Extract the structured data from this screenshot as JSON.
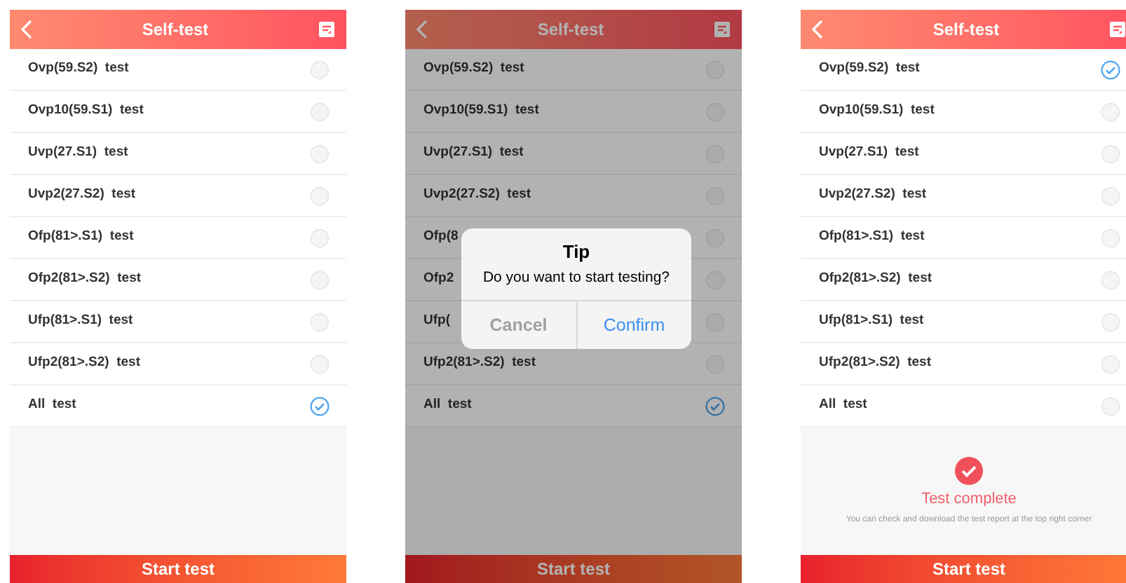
{
  "screens": [
    {
      "title": "Self-test",
      "dimmed": false,
      "tests": [
        {
          "label": "Ovp(59.S2)  test",
          "checked": false
        },
        {
          "label": "Ovp10(59.S1)  test",
          "checked": false
        },
        {
          "label": "Uvp(27.S1)  test",
          "checked": false
        },
        {
          "label": "Uvp2(27.S2)  test",
          "checked": false
        },
        {
          "label": "Ofp(81>.S1)  test",
          "checked": false
        },
        {
          "label": "Ofp2(81>.S2)  test",
          "checked": false
        },
        {
          "label": "Ufp(81>.S1)  test",
          "checked": false
        },
        {
          "label": "Ufp2(81>.S2)  test",
          "checked": false
        },
        {
          "label": "All  test",
          "checked": true
        }
      ],
      "button": "Start test"
    },
    {
      "title": "Self-test",
      "dimmed": true,
      "tests": [
        {
          "label": "Ovp(59.S2)  test",
          "checked": false
        },
        {
          "label": "Ovp10(59.S1)  test",
          "checked": false
        },
        {
          "label": "Uvp(27.S1)  test",
          "checked": false
        },
        {
          "label": "Uvp2(27.S2)  test",
          "checked": false
        },
        {
          "label": "Ofp(8",
          "checked": false
        },
        {
          "label": "Ofp2",
          "checked": false
        },
        {
          "label": "Ufp(",
          "checked": false
        },
        {
          "label": "Ufp2(81>.S2)  test",
          "checked": false
        },
        {
          "label": "All  test",
          "checked": true
        }
      ],
      "button": "Start test",
      "dialog": {
        "title": "Tip",
        "message": "Do you want to start testing?",
        "buttons": [
          {
            "label": "Cancel",
            "kind": "cancel"
          },
          {
            "label": "Confirm",
            "kind": "confirm"
          }
        ]
      }
    },
    {
      "title": "Self-test",
      "dimmed": false,
      "tests": [
        {
          "label": "Ovp(59.S2)  test",
          "checked": true
        },
        {
          "label": "Ovp10(59.S1)  test",
          "checked": false
        },
        {
          "label": "Uvp(27.S1)  test",
          "checked": false
        },
        {
          "label": "Uvp2(27.S2)  test",
          "checked": false
        },
        {
          "label": "Ofp(81>.S1)  test",
          "checked": false
        },
        {
          "label": "Ofp2(81>.S2)  test",
          "checked": false
        },
        {
          "label": "Ufp(81>.S1)  test",
          "checked": false
        },
        {
          "label": "Ufp2(81>.S2)  test",
          "checked": false
        },
        {
          "label": "All  test",
          "checked": false
        }
      ],
      "button": "Start test",
      "result": {
        "title": "Test complete",
        "message": "You can check and download the test report at the top right corner"
      }
    }
  ]
}
